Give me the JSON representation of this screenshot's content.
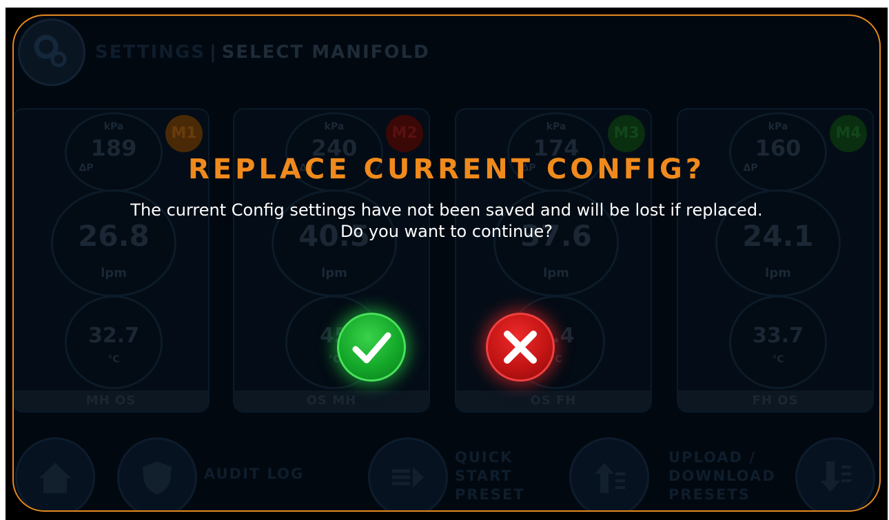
{
  "header": {
    "section": "SETTINGS",
    "separator": "|",
    "title": "SELECT MANIFOLD",
    "gear_icon": "gear-icon"
  },
  "manifolds": [
    {
      "badge": "M1",
      "badge_color": "#5a3208",
      "pressure_unit": "kPa",
      "pressure": "189",
      "delta": "ΔP",
      "flow": "26.8",
      "flow_unit": "lpm",
      "temp": "32.7",
      "temp_unit": "°C",
      "name": "MH OS"
    },
    {
      "badge": "M2",
      "badge_color": "#4a0a08",
      "pressure_unit": "kPa",
      "pressure": "240",
      "delta": "ΔP",
      "flow": "40.5",
      "flow_unit": "lpm",
      "temp": "45",
      "temp_unit": "°C",
      "name": "OS MH"
    },
    {
      "badge": "M3",
      "badge_color": "#0e3a14",
      "pressure_unit": "kPa",
      "pressure": "174",
      "delta": "ΔP",
      "flow": "37.6",
      "flow_unit": "lpm",
      "temp": "5.4",
      "temp_unit": "°C",
      "name": "OS FH"
    },
    {
      "badge": "M4",
      "badge_color": "#0e3a14",
      "pressure_unit": "kPa",
      "pressure": "160",
      "delta": "ΔP",
      "flow": "24.1",
      "flow_unit": "lpm",
      "temp": "33.7",
      "temp_unit": "°C",
      "name": "FH OS"
    }
  ],
  "bottom_bar": {
    "home_icon": "home-icon",
    "audit_log_label": "AUDIT LOG",
    "quick_start_label": [
      "QUICK",
      "START",
      "PRESET"
    ],
    "upload_download_label": [
      "UPLOAD /",
      "DOWNLOAD",
      "PRESETS"
    ]
  },
  "dialog": {
    "title": "REPLACE CURRENT CONFIG?",
    "message_line1": "The current Config settings have not been saved and will be lost if replaced.",
    "message_line2": "Do you want to continue?",
    "confirm_icon": "checkmark-icon",
    "cancel_icon": "x-icon",
    "accent_color": "#f08a1c",
    "confirm_color": "#1db431",
    "cancel_color": "#d21a1a"
  }
}
